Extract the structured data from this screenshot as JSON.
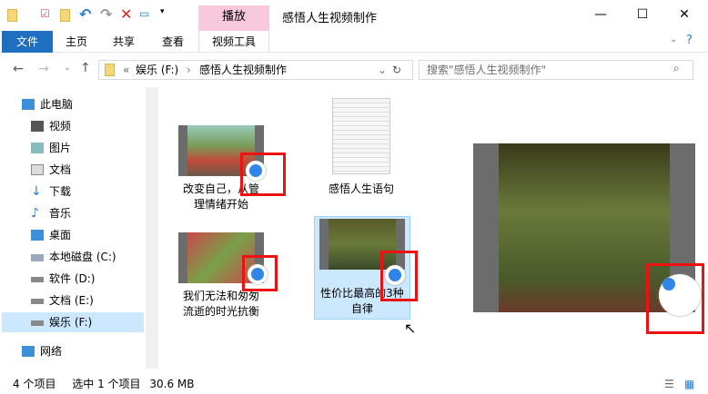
{
  "window": {
    "title": "感悟人生视频制作",
    "context_tab": "播放",
    "context_group": "视频工具"
  },
  "ribbon": {
    "tabs": [
      "文件",
      "主页",
      "共享",
      "查看"
    ],
    "tool_tab": "视频工具"
  },
  "address": {
    "overflow": "«",
    "crumbs": [
      "娱乐 (F:)",
      "感悟人生视频制作"
    ]
  },
  "search": {
    "placeholder": "搜索\"感悟人生视频制作\""
  },
  "nav": [
    "此电脑",
    "视频",
    "图片",
    "文档",
    "下载",
    "音乐",
    "桌面",
    "本地磁盘 (C:)",
    "软件 (D:)",
    "文档 (E:)",
    "娱乐 (F:)",
    "网络"
  ],
  "files": [
    {
      "name": "改变自己，从管理情绪开始",
      "type": "video",
      "colors": [
        "#7a9c5a",
        "#c04a3a"
      ]
    },
    {
      "name": "感悟人生语句",
      "type": "text"
    },
    {
      "name": "我们无法和匆匆流逝的时光抗衡",
      "type": "video",
      "colors": [
        "#c84a4a",
        "#7aa04a"
      ]
    },
    {
      "name": "性价比最高的3种自律",
      "type": "video",
      "selected": true,
      "colors": [
        "#6a7a3a",
        "#4a5a2a"
      ]
    }
  ],
  "status": {
    "count": "4 个项目",
    "selected": "选中 1 个项目",
    "size": "30.6 MB"
  }
}
